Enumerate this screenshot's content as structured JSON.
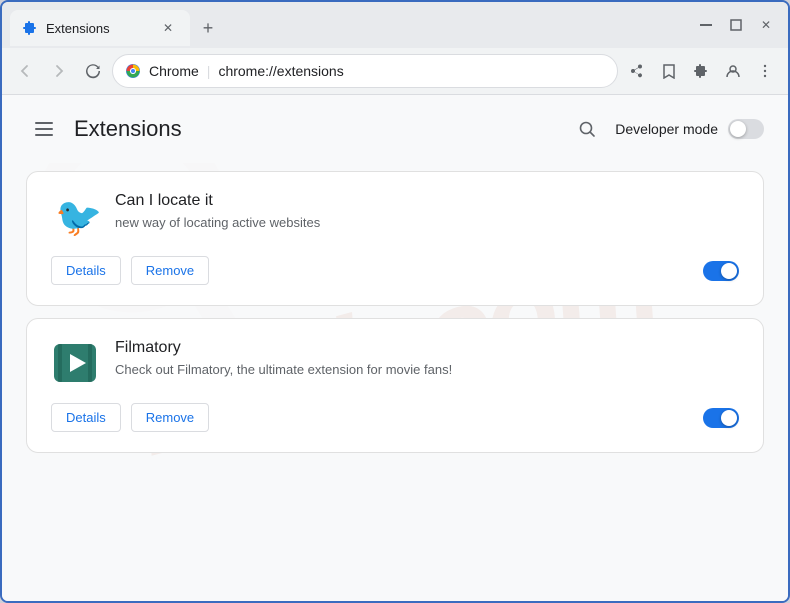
{
  "window": {
    "title": "Extensions",
    "tab_title": "Extensions",
    "url_prefix": "Chrome",
    "url": "chrome://extensions",
    "controls": {
      "minimize": "—",
      "maximize": "□",
      "close": "✕",
      "new_tab": "+"
    }
  },
  "header": {
    "title": "Extensions",
    "search_icon": "search-icon",
    "developer_mode_label": "Developer mode",
    "developer_mode_on": false
  },
  "extensions": [
    {
      "id": "can-locate-it",
      "name": "Can I locate it",
      "description": "new way of locating active websites",
      "details_label": "Details",
      "remove_label": "Remove",
      "enabled": true,
      "icon_type": "bird"
    },
    {
      "id": "filmatory",
      "name": "Filmatory",
      "description": "Check out Filmatory, the ultimate extension for movie fans!",
      "details_label": "Details",
      "remove_label": "Remove",
      "enabled": true,
      "icon_type": "film"
    }
  ],
  "watermark": "riash.com"
}
